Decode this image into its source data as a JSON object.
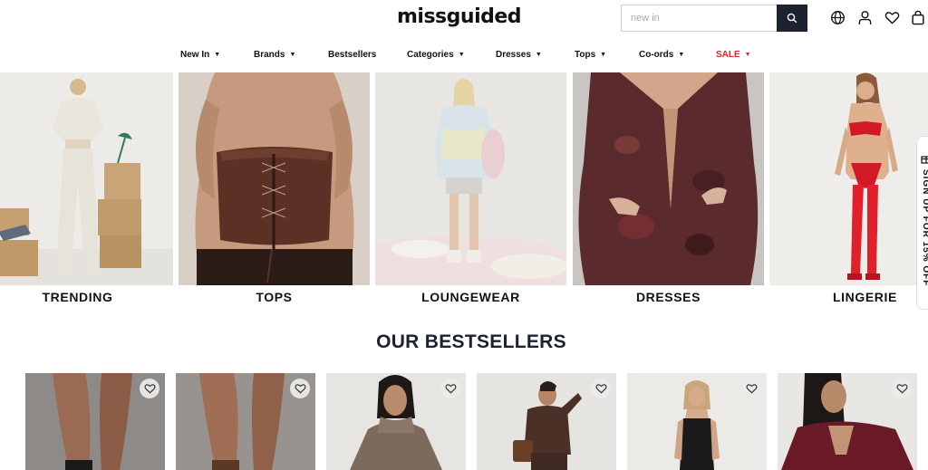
{
  "brand": {
    "logo_text": "missguided"
  },
  "search": {
    "placeholder": "new in",
    "value": ""
  },
  "header_icons": [
    "globe-icon",
    "user-icon",
    "heart-icon",
    "bag-icon"
  ],
  "nav": {
    "items": [
      {
        "label": "New In",
        "dropdown": true
      },
      {
        "label": "Brands",
        "dropdown": true
      },
      {
        "label": "Bestsellers",
        "dropdown": false
      },
      {
        "label": "Categories",
        "dropdown": true
      },
      {
        "label": "Dresses",
        "dropdown": true
      },
      {
        "label": "Tops",
        "dropdown": true
      },
      {
        "label": "Co-ords",
        "dropdown": true
      },
      {
        "label": "SALE",
        "dropdown": true
      }
    ],
    "caret": "▼",
    "sale_color": "#e0202a"
  },
  "categories": [
    {
      "label": "TRENDING"
    },
    {
      "label": "TOPS"
    },
    {
      "label": "LOUNGEWEAR"
    },
    {
      "label": "DRESSES"
    },
    {
      "label": "LINGERIE"
    }
  ],
  "side_tab": {
    "label": "SIGN UP FOR 15% OFF"
  },
  "bestsellers": {
    "title": "OUR BESTSELLERS",
    "products": [
      {
        "image": "legs-black-heels"
      },
      {
        "image": "legs-brown-heels"
      },
      {
        "image": "woman-tweed-coat"
      },
      {
        "image": "woman-brown-jacket"
      },
      {
        "image": "woman-black-jumpsuit"
      },
      {
        "image": "woman-burgundy-top"
      }
    ]
  },
  "colors": {
    "accent_dark": "#1c2230",
    "sale": "#e0202a"
  }
}
